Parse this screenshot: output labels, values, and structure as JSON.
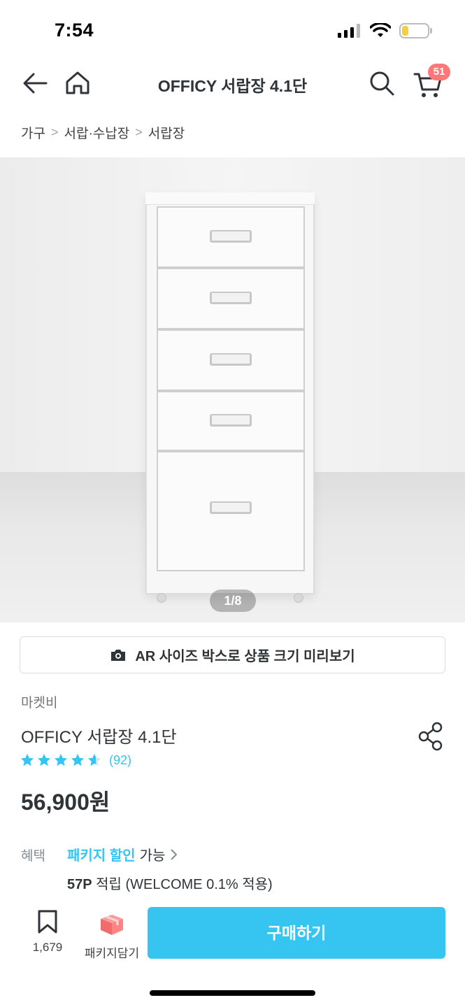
{
  "status_bar": {
    "time": "7:54",
    "battery_color": "#f4d03f"
  },
  "header": {
    "title": "OFFICY 서랍장 4.1단",
    "cart_count": "51",
    "icons": [
      "back-arrow-icon",
      "home-icon",
      "search-icon",
      "cart-icon"
    ]
  },
  "breadcrumb": [
    "가구",
    "서랍·수납장",
    "서랍장"
  ],
  "gallery": {
    "pager": "1/8"
  },
  "ar_button": {
    "label": "AR 사이즈 박스로 상품 크기 미리보기",
    "icon": "camera-icon"
  },
  "product": {
    "brand": "마켓비",
    "name": "OFFICY 서랍장 4.1단",
    "rating": 4.6,
    "review_count": "(92)",
    "price": "56,900원"
  },
  "benefits": {
    "label": "혜택",
    "package_highlight": "패키지 할인",
    "package_suffix": "가능",
    "points_value": "57P",
    "points_text": "적립 (WELCOME 0.1% 적용)"
  },
  "bottom_bar": {
    "bookmark_count": "1,679",
    "package_label": "패키지담기",
    "buy_label": "구매하기"
  },
  "colors": {
    "accent": "#35c5f0",
    "badge": "#ff7777",
    "text": "#2f3438"
  }
}
